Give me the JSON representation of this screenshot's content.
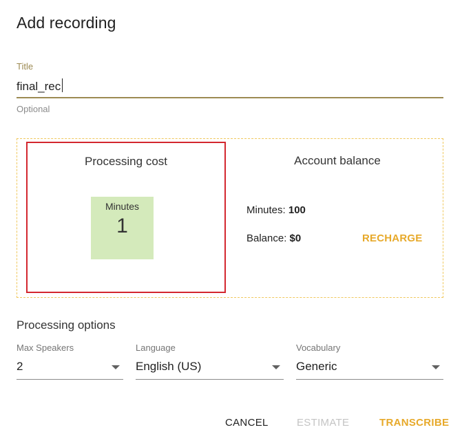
{
  "dialog": {
    "title": "Add recording"
  },
  "title_field": {
    "label": "Title",
    "value": "final_rec",
    "helper": "Optional"
  },
  "cost": {
    "heading": "Processing cost",
    "tile_label": "Minutes",
    "tile_value": "1"
  },
  "account": {
    "heading": "Account balance",
    "minutes_label": "Minutes:",
    "minutes_value": "100",
    "balance_label": "Balance:",
    "balance_value": "$0",
    "recharge_label": "RECHARGE"
  },
  "options": {
    "heading": "Processing options",
    "max_speakers": {
      "label": "Max Speakers",
      "value": "2"
    },
    "language": {
      "label": "Language",
      "value": "English (US)"
    },
    "vocabulary": {
      "label": "Vocabulary",
      "value": "Generic"
    }
  },
  "actions": {
    "cancel": "CANCEL",
    "estimate": "ESTIMATE",
    "transcribe": "TRANSCRIBE"
  },
  "colors": {
    "accent": "#e7a92a",
    "field_underline": "#9c8a52",
    "highlight_border": "#d3262e",
    "tile_bg": "#d4eabb"
  }
}
